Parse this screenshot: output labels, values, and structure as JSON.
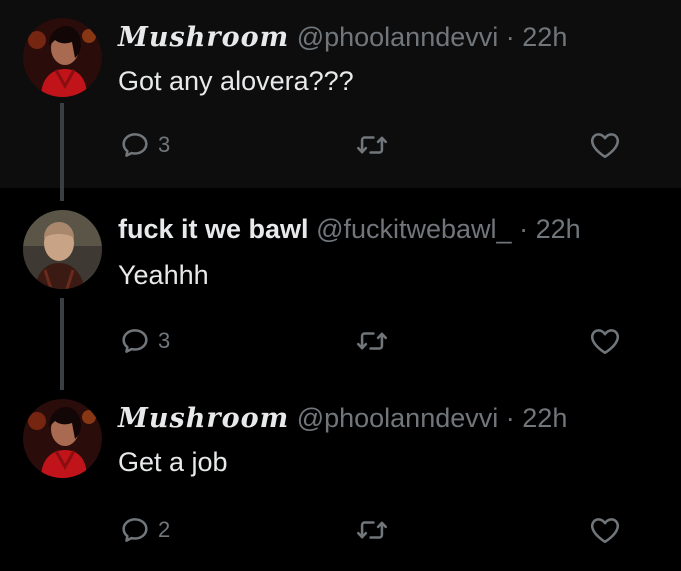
{
  "tweets": [
    {
      "display_name": "Mushroom",
      "handle": "@phoolanndevvi",
      "separator": "·",
      "time": "22h",
      "text": "Got any alovera???",
      "reply_count": "3"
    },
    {
      "display_name": "fuck it we bawl",
      "handle": "@fuckitwebawl_",
      "separator": "·",
      "time": "22h",
      "text": "Yeahhh",
      "reply_count": "3"
    },
    {
      "display_name": "Mushroom",
      "handle": "@phoolanndevvi",
      "separator": "·",
      "time": "22h",
      "text": "Get a job",
      "reply_count": "2"
    }
  ],
  "icons": {
    "reply": "reply-icon",
    "retweet": "retweet-icon",
    "like": "heart-icon"
  },
  "colors": {
    "background": "#000000",
    "first_tweet_background": "#0d0d0d",
    "text": "#e7e9ea",
    "secondary": "#71767b",
    "thread_line": "#3a3f44"
  }
}
